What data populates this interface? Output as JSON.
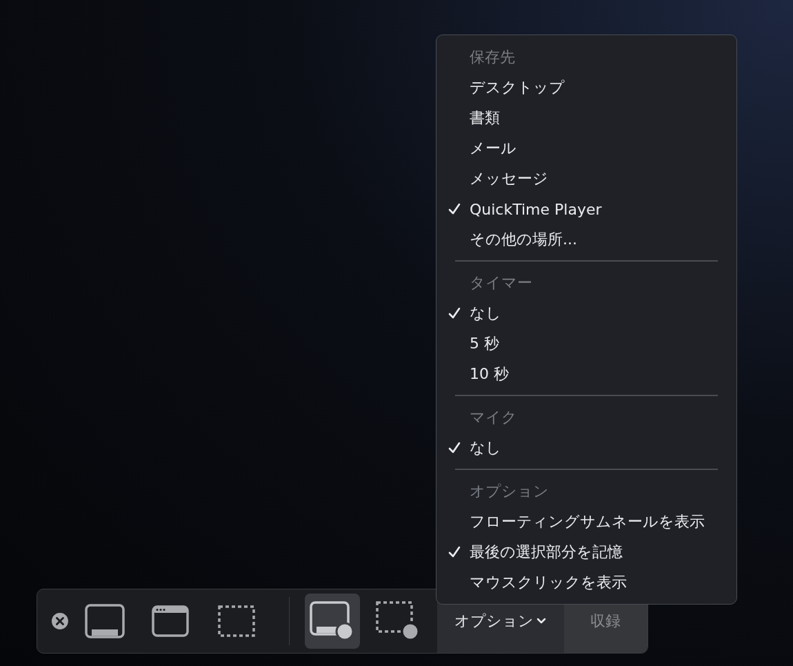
{
  "menu": {
    "sections": [
      {
        "title": "保存先",
        "items": [
          {
            "label": "デスクトップ",
            "checked": false
          },
          {
            "label": "書類",
            "checked": false
          },
          {
            "label": "メール",
            "checked": false
          },
          {
            "label": "メッセージ",
            "checked": false
          },
          {
            "label": "QuickTime Player",
            "checked": true
          },
          {
            "label": "その他の場所...",
            "checked": false
          }
        ]
      },
      {
        "title": "タイマー",
        "items": [
          {
            "label": "なし",
            "checked": true
          },
          {
            "label": "5 秒",
            "checked": false
          },
          {
            "label": "10 秒",
            "checked": false
          }
        ]
      },
      {
        "title": "マイク",
        "items": [
          {
            "label": "なし",
            "checked": true
          }
        ]
      },
      {
        "title": "オプション",
        "items": [
          {
            "label": "フローティングサムネールを表示",
            "checked": false
          },
          {
            "label": "最後の選択部分を記憶",
            "checked": true
          },
          {
            "label": "マウスクリックを表示",
            "checked": false
          }
        ]
      }
    ]
  },
  "toolbar": {
    "tool_groups": [
      [
        {
          "kind": "screen",
          "selected": false
        },
        {
          "kind": "window",
          "selected": false
        },
        {
          "kind": "selection",
          "selected": false
        }
      ],
      [
        {
          "kind": "screen-record",
          "selected": true
        },
        {
          "kind": "selection-record",
          "selected": false
        }
      ]
    ],
    "options_button": {
      "label": "オプション"
    },
    "record_button": {
      "label": "収録",
      "disabled": true
    }
  }
}
